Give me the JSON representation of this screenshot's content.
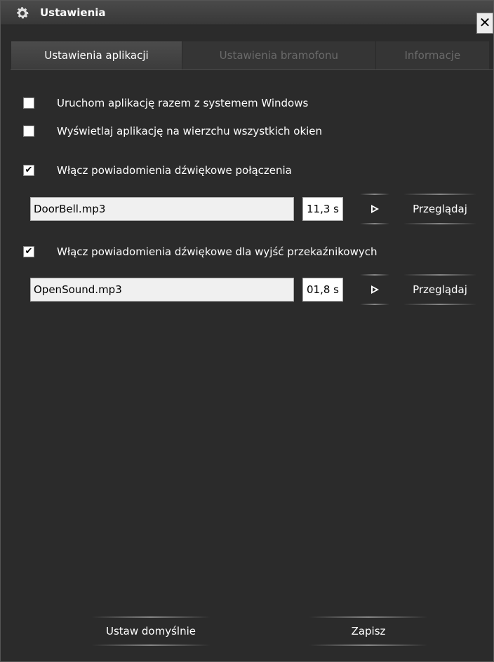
{
  "window": {
    "title": "Ustawienia",
    "close_glyph": "✕"
  },
  "tabs": [
    {
      "label": "Ustawienia aplikacji",
      "active": true
    },
    {
      "label": "Ustawienia bramofonu",
      "active": false
    },
    {
      "label": "Informacje",
      "active": false
    }
  ],
  "options": {
    "autostart": {
      "label": "Uruchom aplikację razem z systemem Windows",
      "checked": false
    },
    "on_top": {
      "label": "Wyświetlaj aplikację na wierzchu wszystkich okien",
      "checked": false
    },
    "call_sound": {
      "label": "Włącz powiadomienia dźwiękowe połączenia",
      "checked": true,
      "file": "DoorBell.mp3",
      "duration": "11,3 s"
    },
    "relay_sound": {
      "label": "Włącz powiadomienia dźwiękowe dla wyjść przekaźnikowych",
      "checked": true,
      "file": "OpenSound.mp3",
      "duration": "01,8 s"
    }
  },
  "buttons": {
    "browse": "Przeglądaj",
    "defaults": "Ustaw domyślnie",
    "save": "Zapisz"
  },
  "icons": {
    "title": "gear-icon",
    "play": "play-icon",
    "check_glyph": "✔"
  },
  "colors": {
    "background": "#2b2b2b",
    "text": "#ffffff",
    "inactive_tab_text": "#6a6a6a"
  }
}
